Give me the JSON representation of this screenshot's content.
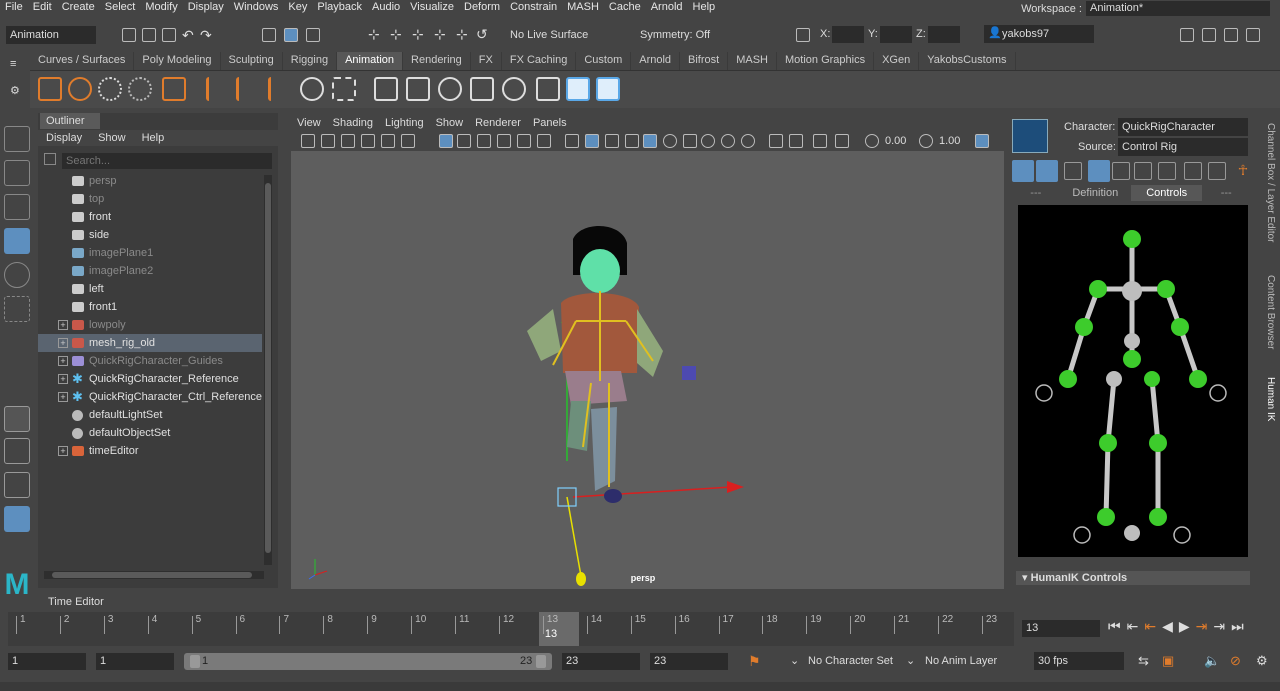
{
  "menubar": {
    "items": [
      "File",
      "Edit",
      "Create",
      "Select",
      "Modify",
      "Display",
      "Windows",
      "Key",
      "Playback",
      "Audio",
      "Visualize",
      "Deform",
      "Constrain",
      "MASH",
      "Cache",
      "Arnold",
      "Help"
    ],
    "workspace_label": "Workspace :",
    "workspace_value": "Animation*"
  },
  "statusline": {
    "menu_set": "Animation",
    "live_surface": "No Live Surface",
    "symmetry": "Symmetry: Off",
    "x_label": "X:",
    "y_label": "Y:",
    "z_label": "Z:",
    "user": "yakobs97"
  },
  "shelf": {
    "tabs": [
      "Curves / Surfaces",
      "Poly Modeling",
      "Sculpting",
      "Rigging",
      "Animation",
      "Rendering",
      "FX",
      "FX Caching",
      "Custom",
      "Arnold",
      "Bifrost",
      "MASH",
      "Motion Graphics",
      "XGen",
      "YakobsCustoms"
    ],
    "active_tab": "Animation"
  },
  "outliner": {
    "title": "Outliner",
    "menu": [
      "Display",
      "Show",
      "Help"
    ],
    "search_placeholder": "Search...",
    "items": [
      {
        "label": "persp",
        "dim": true,
        "icon": "camera-icon",
        "expand": false
      },
      {
        "label": "top",
        "dim": true,
        "icon": "camera-icon",
        "expand": false
      },
      {
        "label": "front",
        "dim": false,
        "icon": "camera-icon",
        "expand": false
      },
      {
        "label": "side",
        "dim": false,
        "icon": "camera-icon",
        "expand": false
      },
      {
        "label": "imagePlane1",
        "dim": true,
        "icon": "image-plane-icon",
        "expand": false
      },
      {
        "label": "imagePlane2",
        "dim": true,
        "icon": "image-plane-icon",
        "expand": false
      },
      {
        "label": "left",
        "dim": false,
        "icon": "camera-icon",
        "expand": false
      },
      {
        "label": "front1",
        "dim": false,
        "icon": "camera-icon",
        "expand": false
      },
      {
        "label": "lowpoly",
        "dim": true,
        "icon": "mesh-icon",
        "expand": true
      },
      {
        "label": "mesh_rig_old",
        "dim": false,
        "icon": "mesh-icon",
        "expand": true,
        "selected": true
      },
      {
        "label": "QuickRigCharacter_Guides",
        "dim": true,
        "icon": "guides-icon",
        "expand": true
      },
      {
        "label": "QuickRigCharacter_Reference",
        "dim": false,
        "icon": "joint-icon",
        "expand": true
      },
      {
        "label": "QuickRigCharacter_Ctrl_Reference",
        "dim": false,
        "icon": "joint-icon",
        "expand": true
      },
      {
        "label": "defaultLightSet",
        "dim": false,
        "icon": "set-icon",
        "expand": false
      },
      {
        "label": "defaultObjectSet",
        "dim": false,
        "icon": "set-icon",
        "expand": false
      },
      {
        "label": "timeEditor",
        "dim": false,
        "icon": "time-editor-icon",
        "expand": true
      }
    ]
  },
  "viewport": {
    "menu": [
      "View",
      "Shading",
      "Lighting",
      "Show",
      "Renderer",
      "Panels"
    ],
    "near": "0.00",
    "far": "1.00",
    "camera_label": "persp"
  },
  "hik": {
    "character_label": "Character:",
    "character_value": "QuickRigCharacter",
    "source_label": "Source:",
    "source_value": "Control Rig",
    "tabs": [
      "---",
      "Definition",
      "Controls",
      "---"
    ],
    "active_tab": "Controls",
    "footer": "HumanIK Controls"
  },
  "sidetabs": [
    "Channel Box / Layer Editor",
    "Content Browser",
    "Human IK"
  ],
  "time_editor_tab": "Time Editor",
  "timeline": {
    "ticks": [
      "1",
      "2",
      "3",
      "4",
      "5",
      "6",
      "7",
      "8",
      "9",
      "10",
      "11",
      "12",
      "13",
      "14",
      "15",
      "16",
      "17",
      "18",
      "19",
      "20",
      "21",
      "22",
      "23"
    ],
    "current": "13",
    "current_field": "13"
  },
  "range": {
    "start": "1",
    "anim_start": "1",
    "slider_start": "1",
    "slider_end": "23",
    "anim_end": "23",
    "end": "23",
    "character_set": "No Character Set",
    "anim_layer": "No Anim Layer",
    "fps": "30 fps"
  },
  "colors": {
    "accent": "#5d8fbf",
    "active_tab": "#575757",
    "hik_green": "#3dcc2c",
    "hik_bg": "#000000"
  }
}
